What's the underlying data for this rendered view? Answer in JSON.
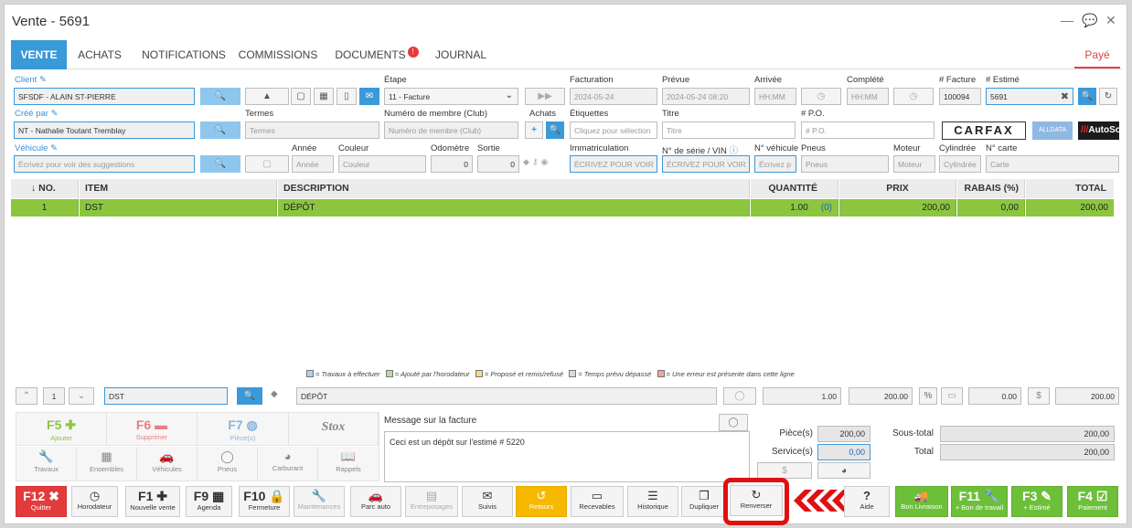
{
  "window": {
    "title": "Vente - 5691"
  },
  "tabs": [
    {
      "label": "VENTE"
    },
    {
      "label": "ACHATS"
    },
    {
      "label": "NOTIFICATIONS"
    },
    {
      "label": "COMMISSIONS"
    },
    {
      "label": "DOCUMENTS",
      "badge": "!"
    },
    {
      "label": "JOURNAL"
    }
  ],
  "status": "Payé",
  "form": {
    "client_label": "Client",
    "client_value": "SFSDF - ALAIN ST-PIERRE",
    "etape_label": "Étape",
    "etape_value": "11 - Facture",
    "facturation_label": "Facturation",
    "facturation_value": "2024-05-24",
    "prevue_label": "Prévue",
    "prevue_value": "2024-05-24 08:20",
    "arrivee_label": "Arrivée",
    "arrivee_ph": "HH:MM",
    "complete_label": "Complété",
    "complete_ph": "HH:MM",
    "facture_label": "# Facture",
    "facture_value": "100094",
    "estime_label": "# Estimé",
    "estime_value": "5691",
    "cree_par_label": "Créé par",
    "cree_par_value": "NT - Nathalie Toutant Tremblay",
    "termes_label": "Termes",
    "termes_ph": "Termes",
    "membre_label": "Numéro de membre (Club)",
    "membre_ph": "Numéro de membre (Club)",
    "achats_label": "Achats",
    "etiquettes_label": "Étiquettes",
    "etiquettes_ph": "Cliquez pour sélection",
    "titre_label": "Titre",
    "titre_ph": "Titre",
    "po_label": "# P.O.",
    "po_ph": "# P.O.",
    "carfax": "CARFAX",
    "alldata": "ALLDATA",
    "autosoft": "AutoSo",
    "vehicule_label": "Véhicule",
    "vehicule_ph": "Écrivez pour voir des suggestions",
    "annee_label": "Année",
    "annee_ph": "Année",
    "couleur_label": "Couleur",
    "couleur_ph": "Couleur",
    "odometre_label": "Odomètre",
    "odometre_value": "0",
    "sortie_label": "Sortie",
    "sortie_value": "0",
    "immat_label": "Immatriculation",
    "immat_ph": "ÉCRIVEZ POUR VOIR",
    "serie_label": "N° de série / VIN",
    "serie_ph": "ÉCRIVEZ POUR VOIR L",
    "nveh_label": "N° véhicule",
    "nveh_ph": "Écrivez p",
    "pneus_label": "Pneus",
    "pneus_ph": "Pneus",
    "moteur_label": "Moteur",
    "moteur_ph": "Moteur",
    "cyl_label": "Cylindrée",
    "cyl_ph": "Cylindrée",
    "carte_label": "N° carte",
    "carte_ph": "Carte"
  },
  "grid": {
    "headers": [
      "↓ NO.",
      "ITEM",
      "DESCRIPTION",
      "QUANTITÉ",
      "PRIX",
      "RABAIS (%)",
      "TOTAL"
    ],
    "rows": [
      {
        "no": "1",
        "item": "DST",
        "description": "DÉPÔT",
        "quantite": "1.00",
        "qte_extra": "(0)",
        "prix": "200,00",
        "rabais": "0,00",
        "total": "200,00"
      }
    ]
  },
  "legend": [
    {
      "text": "= Travaux à effectuer",
      "color": "#a9d3f5"
    },
    {
      "text": "= Ajouté par l'horodateur",
      "color": "#b9dba0"
    },
    {
      "text": "= Proposé et remis/refusé",
      "color": "#f5dc7a"
    },
    {
      "text": "= Temps prévu dépassé",
      "color": "#d9d9d9"
    },
    {
      "text": "= Une erreur est présente dans cette ligne",
      "color": "#f3a3a3"
    }
  ],
  "edit": {
    "line_no": "1",
    "item": "DST",
    "description": "DÉPÔT",
    "quantite": "1.00",
    "prix": "200.00",
    "rabais": "0.00",
    "total": "200.00"
  },
  "quick": {
    "f5": "F5",
    "f5_s": "Ajouter",
    "f6": "F6",
    "f6_s": "Supprimer",
    "f7": "F7",
    "f7_s": "Pièce(s)",
    "stox": "Stox",
    "row2": [
      "Travaux",
      "Ensembles",
      "Véhicules",
      "Pneus",
      "Carburant",
      "Rappels"
    ]
  },
  "message": {
    "label": "Message sur la facture",
    "text": "Ceci est un dépôt sur l'estimé # 5220"
  },
  "totals": {
    "pieces_label": "Pièce(s)",
    "pieces_value": "200,00",
    "service_label": "Service(s)",
    "service_value": "0,00",
    "soustotal_label": "Sous-total",
    "soustotal_value": "200,00",
    "total_label": "Total",
    "total_value": "200,00"
  },
  "bottom": [
    {
      "key": "F12",
      "label": "Quitter"
    },
    {
      "label": "Horodateur"
    },
    {
      "key": "F1",
      "label": "Nouvelle vente"
    },
    {
      "key": "F9",
      "label": "Agenda"
    },
    {
      "key": "F10",
      "label": "Fermeture"
    },
    {
      "label": "Maintenances"
    },
    {
      "label": "Parc auto"
    },
    {
      "label": "Entreposages"
    },
    {
      "label": "Suivis"
    },
    {
      "label": "Retours"
    },
    {
      "label": "Recevables"
    },
    {
      "label": "Historique"
    },
    {
      "label": "Dupliquer"
    },
    {
      "label": "Renverser"
    },
    {
      "label": "Aide"
    },
    {
      "label": "Bon Livraison"
    },
    {
      "key": "F11",
      "label": "+ Bon de travail"
    },
    {
      "key": "F3",
      "label": "+ Estimé"
    },
    {
      "key": "F4",
      "label": "Paiement"
    }
  ],
  "colors": {
    "accent": "#3a99d8",
    "highlight": "#e01010",
    "row_green": "#8cc63f"
  }
}
